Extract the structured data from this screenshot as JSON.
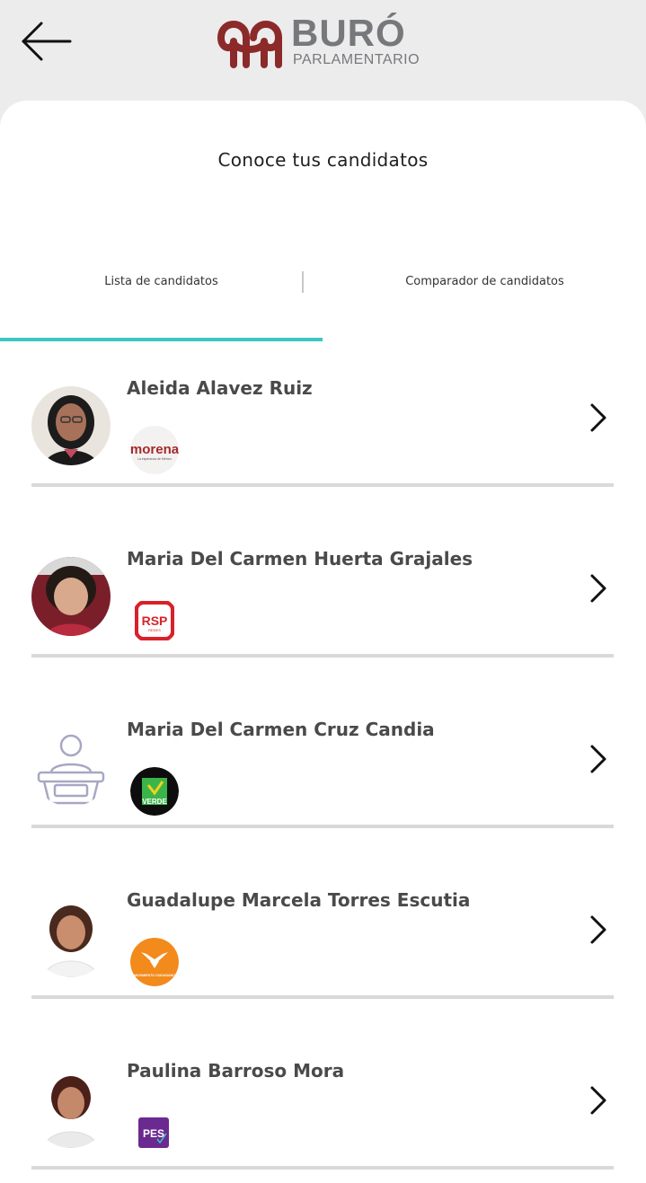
{
  "header": {
    "back_icon": "arrow-left-icon",
    "logo_title": "BURÓ",
    "logo_subtitle": "PARLAMENTARIO",
    "brand_color": "#8c2a2a"
  },
  "page": {
    "title": "Conoce tus candidatos"
  },
  "tabs": [
    {
      "label": "Lista de candidatos",
      "active": true
    },
    {
      "label": "Comparador de candidatos",
      "active": false
    }
  ],
  "accent_color": "#3ec7c1",
  "candidates": [
    {
      "name": "Aleida Alavez Ruiz",
      "party_logo_text": "morena",
      "party_logo_sub": "La esperanza de México",
      "avatar": "photo",
      "chevron": "chevron-right-icon"
    },
    {
      "name": "Maria Del Carmen Huerta Grajales",
      "party_logo_text": "RSP",
      "party_logo_sub": "REDES",
      "avatar": "photo",
      "chevron": "chevron-right-icon"
    },
    {
      "name": "Maria Del Carmen Cruz Candia",
      "party_logo_text": "VERDE",
      "party_logo_sub": "",
      "avatar": "placeholder-podium-icon",
      "chevron": "chevron-right-icon"
    },
    {
      "name": "Guadalupe Marcela Torres Escutia",
      "party_logo_text": "MOVIMIENTO CIUDADANO",
      "party_logo_sub": "",
      "avatar": "photo",
      "chevron": "chevron-right-icon"
    },
    {
      "name": "Paulina Barroso Mora",
      "party_logo_text": "PES",
      "party_logo_sub": "",
      "avatar": "photo",
      "chevron": "chevron-right-icon"
    }
  ]
}
